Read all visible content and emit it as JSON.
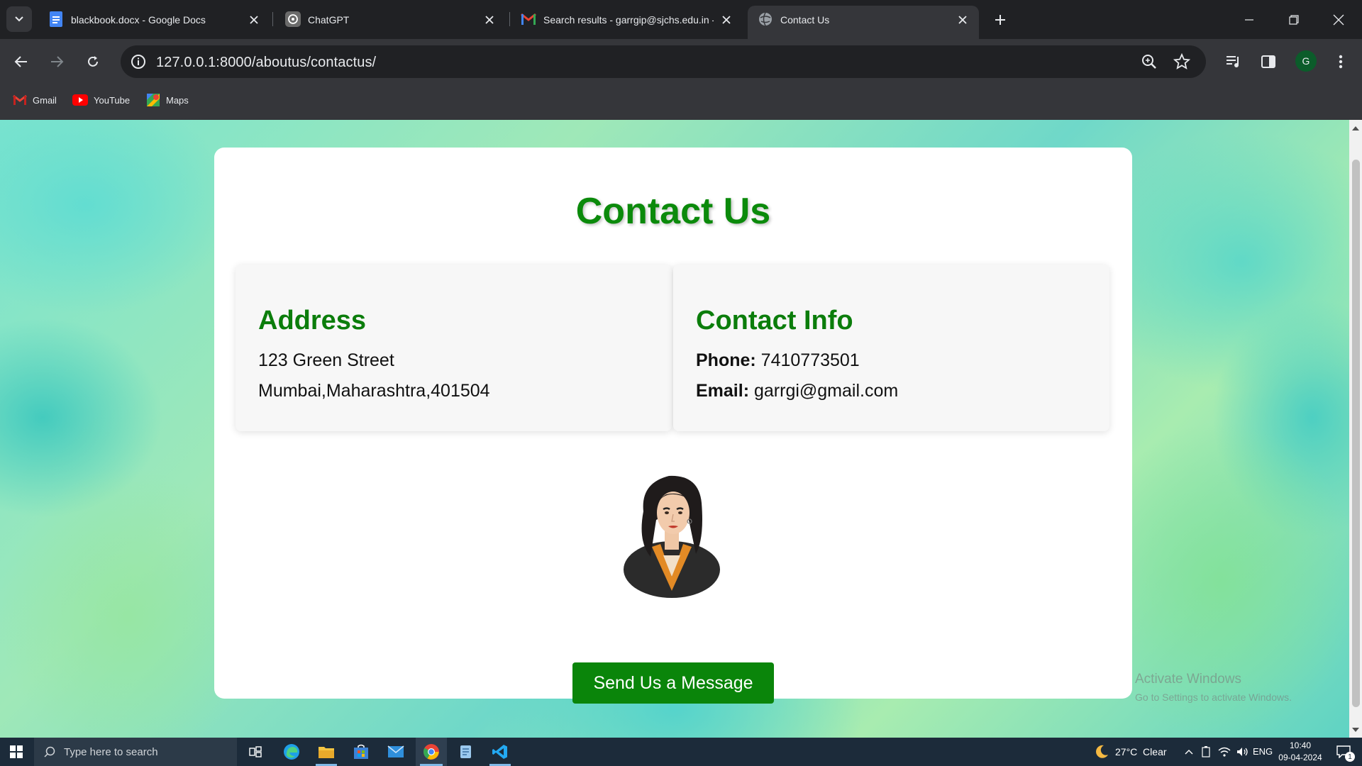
{
  "browser": {
    "tabs": [
      {
        "title": "blackbook.docx - Google Docs",
        "icon": "google-docs-icon",
        "active": false
      },
      {
        "title": "ChatGPT",
        "icon": "chatgpt-icon",
        "active": false
      },
      {
        "title": "Search results - garrgip@sjchs.edu.in - Alc",
        "icon": "gmail-icon",
        "active": false
      },
      {
        "title": "Contact Us",
        "icon": "globe-icon",
        "active": true
      }
    ],
    "url": "127.0.0.1:8000/aboutus/contactus/",
    "profile_initial": "G",
    "bookmarks": [
      {
        "label": "Gmail",
        "icon": "gmail-icon"
      },
      {
        "label": "YouTube",
        "icon": "youtube-icon"
      },
      {
        "label": "Maps",
        "icon": "maps-icon"
      }
    ]
  },
  "page": {
    "title": "Contact Us",
    "address": {
      "heading": "Address",
      "line1": "123 Green Street",
      "line2": "Mumbai,Maharashtra,401504"
    },
    "contact": {
      "heading": "Contact Info",
      "phone_label": "Phone:",
      "phone": "7410773501",
      "email_label": "Email:",
      "email": "garrgi@gmail.com"
    },
    "button_label": "Send Us a Message",
    "watermark_line1": "Activate Windows",
    "watermark_line2": "Go to Settings to activate Windows."
  },
  "taskbar": {
    "search_placeholder": "Type here to search",
    "weather": "27°C  Clear",
    "language": "ENG",
    "time": "10:40",
    "date": "09-04-2024",
    "notification_count": "1"
  },
  "colors": {
    "heading_green": "#0b8a0b",
    "button_green": "#0a850a",
    "chrome_dark": "#202124",
    "chrome_toolbar": "#35363a"
  }
}
